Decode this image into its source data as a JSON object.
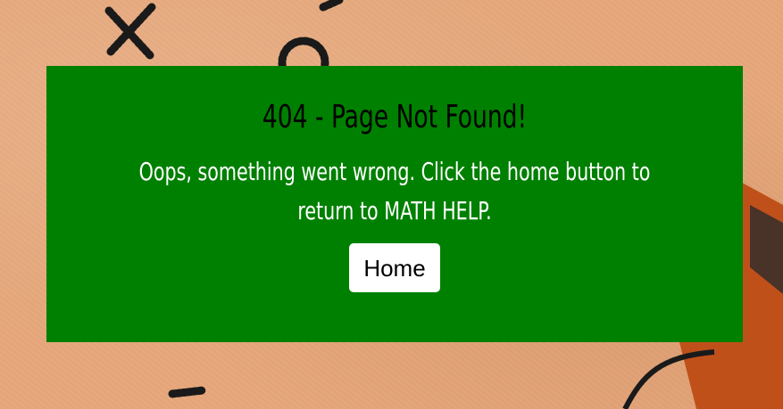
{
  "error": {
    "title": "404 - Page Not Found!",
    "message": "Oops, something went wrong. Click the home button to return to MATH HELP.",
    "home_button_label": "Home"
  },
  "colors": {
    "panel_background": "#008000",
    "title_text": "#000000",
    "message_text": "#ffffff",
    "button_background": "#ffffff",
    "page_background": "#e6a87c"
  }
}
